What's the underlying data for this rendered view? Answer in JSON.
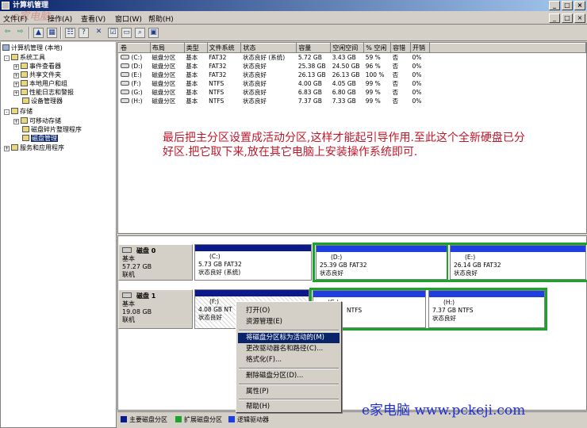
{
  "window": {
    "title": "计算机管理",
    "controls": [
      "_",
      "□",
      "×"
    ]
  },
  "watermark": "e家电脑",
  "menu": {
    "items": [
      "文件(F)",
      "操作(A)",
      "查看(V)",
      "窗口(W)",
      "帮助(H)"
    ],
    "mdi_controls": [
      "_",
      "□",
      "×"
    ]
  },
  "toolbar": {
    "icons": [
      "back-arrow",
      "forward-arrow",
      "up-folder",
      "show-tree",
      "properties",
      "help",
      "delete",
      "checklist",
      "open-folder",
      "search",
      "disk"
    ]
  },
  "tree": {
    "root": "计算机管理 (本地)",
    "items": [
      {
        "label": "系统工具",
        "expander": "-"
      },
      {
        "label": "事件查看器",
        "expander": "+"
      },
      {
        "label": "共享文件夹",
        "expander": "+"
      },
      {
        "label": "本地用户和组",
        "expander": "+"
      },
      {
        "label": "性能日志和警报",
        "expander": "+"
      },
      {
        "label": "设备管理器",
        "expander": ""
      },
      {
        "label": "存储",
        "expander": "-"
      },
      {
        "label": "可移动存储",
        "expander": "+"
      },
      {
        "label": "磁盘碎片整理程序",
        "expander": ""
      },
      {
        "label": "磁盘管理",
        "expander": ""
      },
      {
        "label": "服务和应用程序",
        "expander": "+"
      }
    ]
  },
  "volumes": {
    "columns": [
      "卷",
      "布局",
      "类型",
      "文件系统",
      "状态",
      "容量",
      "空闲空间",
      "% 空闲",
      "容错",
      "开销"
    ],
    "rows": [
      [
        "(C:)",
        "磁盘分区",
        "基本",
        "FAT32",
        "状态良好 (系统)",
        "5.72 GB",
        "3.43 GB",
        "59 %",
        "否",
        "0%"
      ],
      [
        "(D:)",
        "磁盘分区",
        "基本",
        "FAT32",
        "状态良好",
        "25.38 GB",
        "24.50 GB",
        "96 %",
        "否",
        "0%"
      ],
      [
        "(E:)",
        "磁盘分区",
        "基本",
        "FAT32",
        "状态良好",
        "26.13 GB",
        "26.13 GB",
        "100 %",
        "否",
        "0%"
      ],
      [
        "(F:)",
        "磁盘分区",
        "基本",
        "NTFS",
        "状态良好",
        "4.00 GB",
        "4.05 GB",
        "99 %",
        "否",
        "0%"
      ],
      [
        "(G:)",
        "磁盘分区",
        "基本",
        "NTFS",
        "状态良好",
        "6.83 GB",
        "6.80 GB",
        "99 %",
        "否",
        "0%"
      ],
      [
        "(H:)",
        "磁盘分区",
        "基本",
        "NTFS",
        "状态良好",
        "7.37 GB",
        "7.33 GB",
        "99 %",
        "否",
        "0%"
      ]
    ]
  },
  "annotation": "最后把主分区设置成活动分区,这样才能起引导作用.至此这个全新硬盘已分好区.把它取下来,放在其它电脑上安装操作系统即可.",
  "disks": [
    {
      "name": "磁盘 0",
      "type": "基本",
      "size": "57.27 GB",
      "status": "联机",
      "partitions": [
        {
          "letter": "(C:)",
          "info": "5.73 GB FAT32",
          "status": "状态良好 (系统)"
        },
        {
          "letter": "(D:)",
          "info": "25.39 GB FAT32",
          "status": "状态良好"
        },
        {
          "letter": "(E:)",
          "info": "26.14 GB FAT32",
          "status": "状态良好"
        }
      ]
    },
    {
      "name": "磁盘 1",
      "type": "基本",
      "size": "19.08 GB",
      "status": "联机",
      "partitions": [
        {
          "letter": "(F:)",
          "info": "4.08 GB NT",
          "status": "状态良好"
        },
        {
          "letter": "(G:)",
          "info": "NTFS",
          "status": ""
        },
        {
          "letter": "(H:)",
          "info": "7.37 GB NTFS",
          "status": "状态良好"
        }
      ]
    }
  ],
  "legend": [
    {
      "label": "主要磁盘分区",
      "color": "#0a1a8a"
    },
    {
      "label": "扩展磁盘分区",
      "color": "#1aa52a"
    },
    {
      "label": "逻辑驱动器",
      "color": "#1f3fe0"
    }
  ],
  "context_menu": {
    "items": [
      "打开(O)",
      "资源管理(E)",
      "将磁盘分区标为活动的(M)",
      "更改驱动器名和路径(C)...",
      "格式化(F)...",
      "删除磁盘分区(D)...",
      "属性(P)",
      "帮助(H)"
    ],
    "highlighted_index": 2
  },
  "credit": "e家电脑 www.pckeji.com",
  "colors": {
    "title_bar": "#0a246a",
    "primary_partition": "#0a1a8a",
    "logical_drive": "#1f3fe0",
    "extended_partition": "#1aa52a",
    "annotation_text": "#c0182b",
    "credit_text": "#1f2fd8"
  }
}
